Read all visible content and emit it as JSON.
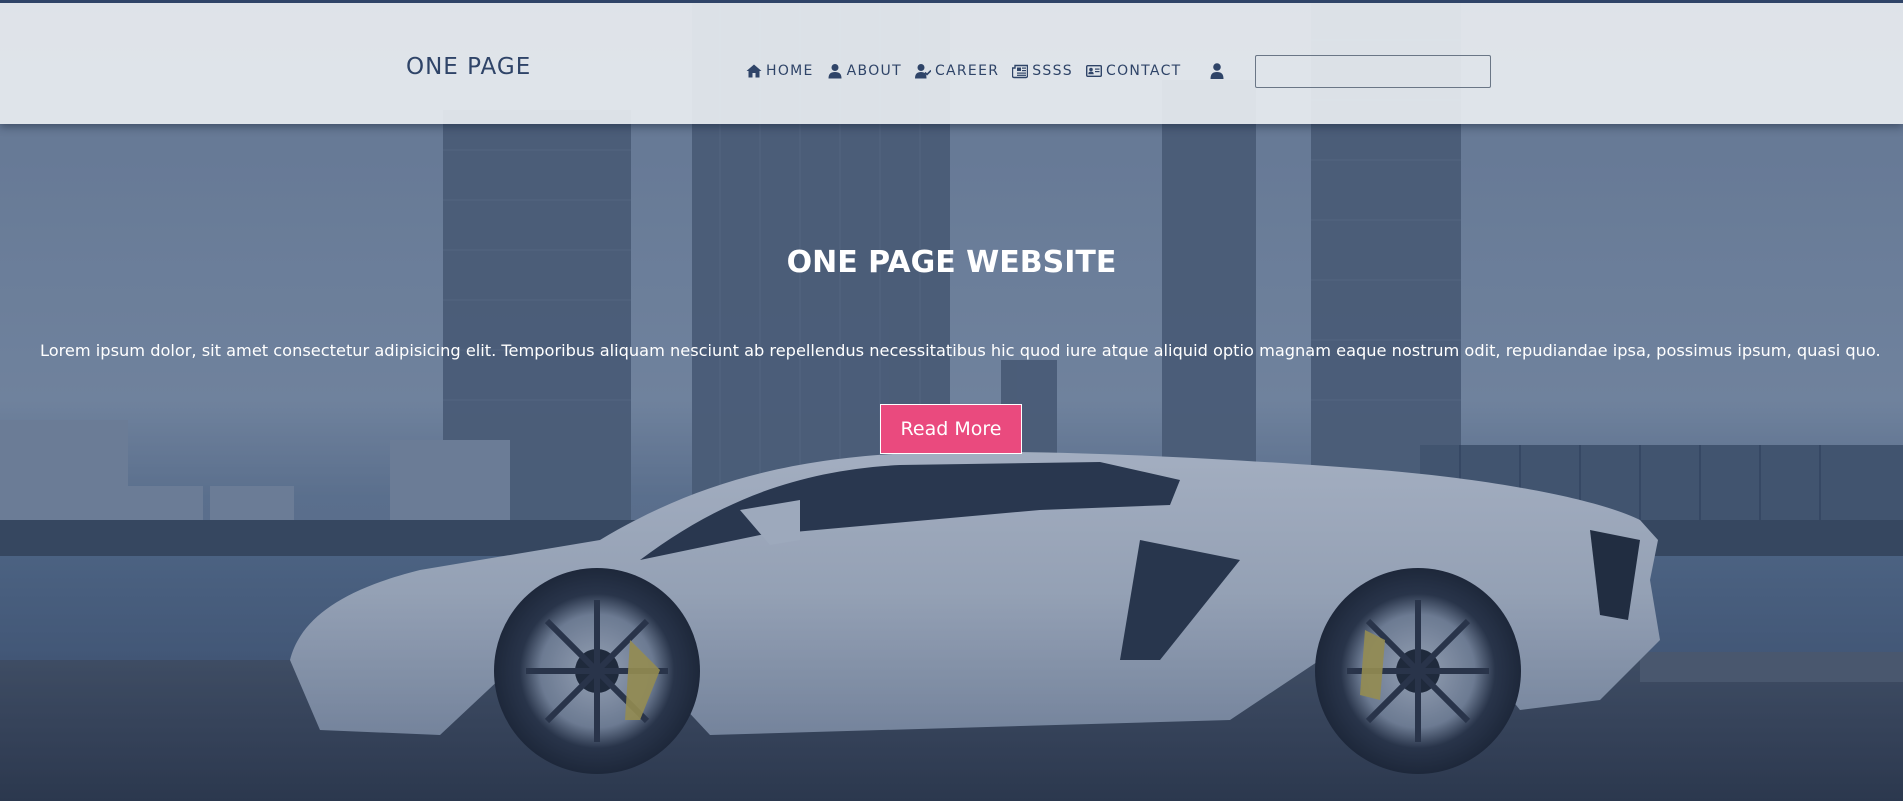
{
  "header": {
    "logo": "ONE PAGE",
    "nav": [
      {
        "label": "HOME",
        "icon": "home-icon"
      },
      {
        "label": "ABOUT",
        "icon": "user-icon"
      },
      {
        "label": "CAREER",
        "icon": "user-check-icon"
      },
      {
        "label": "SSSS",
        "icon": "newspaper-icon"
      },
      {
        "label": "CONTACT",
        "icon": "address-card-icon"
      }
    ],
    "account_icon": "user-icon",
    "search": {
      "value": "",
      "placeholder": ""
    }
  },
  "hero": {
    "title": "ONE PAGE WEBSITE",
    "text": "Lorem ipsum dolor, sit amet consectetur adipisicing elit. Temporibus aliquam nesciunt ab repellendus necessitatibus hic quod iure atque aliquid optio magnam eaque nostrum odit, repudiandae ipsa, possimus ipsum, quasi quo.",
    "button_label": "Read More"
  },
  "colors": {
    "primary": "#2f4468",
    "accent": "#ea4a7e",
    "header_bg": "#eceff3",
    "hero_text": "#ffffff"
  }
}
